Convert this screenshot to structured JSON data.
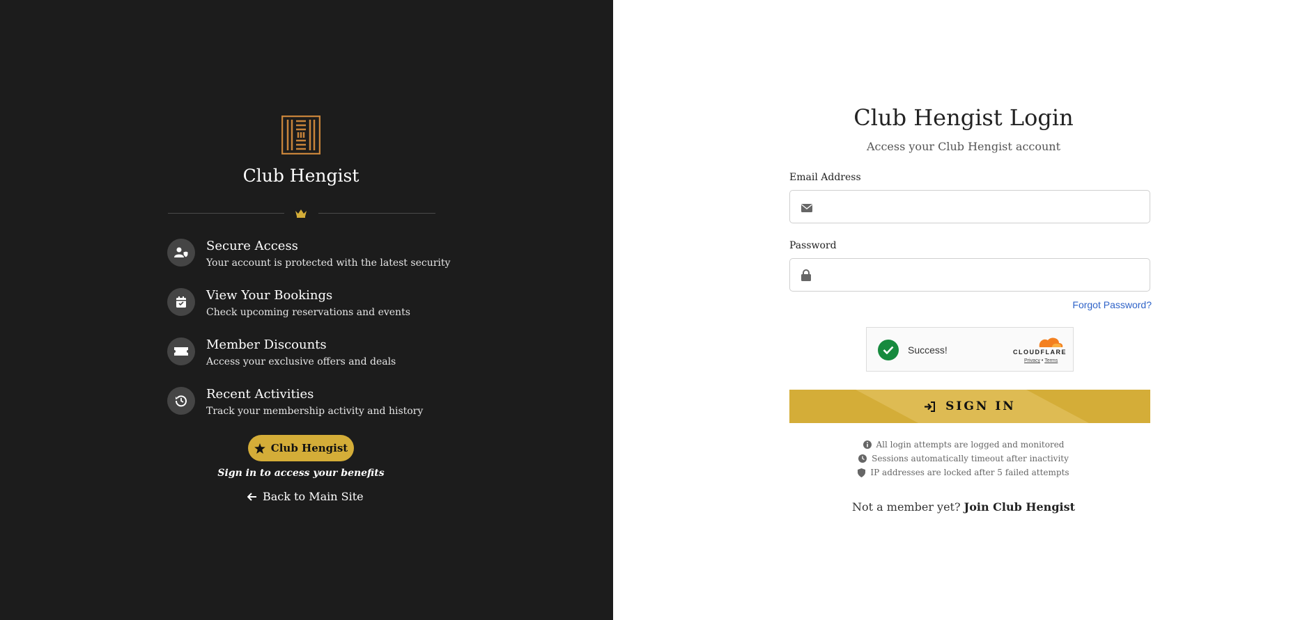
{
  "colors": {
    "left_bg": "#1c1c1c",
    "accent_gold": "#d4ad38",
    "logo_copper": "#c8843a",
    "link_blue": "#2f63c8"
  },
  "sidebar": {
    "logo_icon": "club-monogram-icon",
    "brand": "Club Hengist",
    "divider_icon": "crown-icon",
    "features": [
      {
        "icon": "user-shield-icon",
        "title": "Secure Access",
        "desc": "Your account is protected with the latest security"
      },
      {
        "icon": "calendar-check-icon",
        "title": "View Your Bookings",
        "desc": "Check upcoming reservations and events"
      },
      {
        "icon": "ticket-icon",
        "title": "Member Discounts",
        "desc": "Access your exclusive offers and deals"
      },
      {
        "icon": "history-icon",
        "title": "Recent Activities",
        "desc": "Track your membership activity and history"
      }
    ],
    "pill_label": "Club Hengist",
    "tagline": "Sign in to access your benefits",
    "back_label": "Back to Main Site"
  },
  "login": {
    "title": "Club Hengist Login",
    "subtitle": "Access your Club Hengist account",
    "email_label": "Email Address",
    "email_value": "",
    "password_label": "Password",
    "password_value": "",
    "forgot": "Forgot Password?",
    "captcha": {
      "status": "Success!",
      "brand": "CLOUDFLARE",
      "privacy": "Privacy",
      "separator": "•",
      "terms": "Terms"
    },
    "signin_label": "SIGN IN",
    "notes": [
      {
        "icon": "info-icon",
        "text": "All login attempts are logged and monitored"
      },
      {
        "icon": "clock-icon",
        "text": "Sessions automatically timeout after inactivity"
      },
      {
        "icon": "shield-icon",
        "text": "IP addresses are locked after 5 failed attempts"
      }
    ],
    "join_prefix": "Not a member yet?",
    "join_link": "Join Club Hengist"
  }
}
